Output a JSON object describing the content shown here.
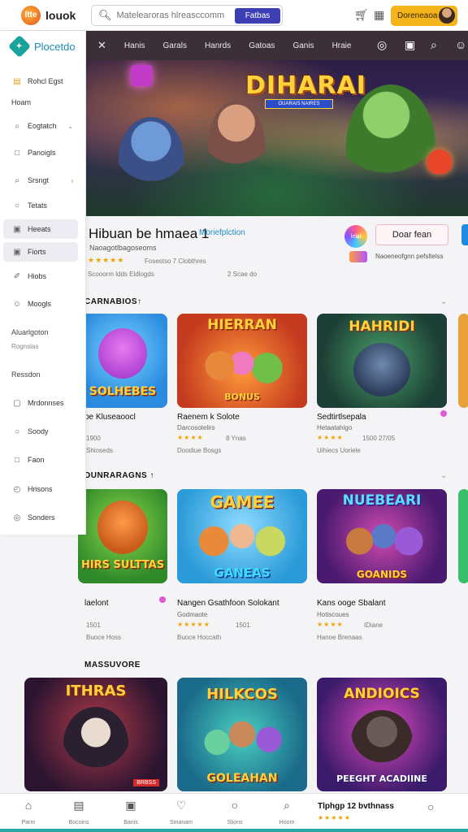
{
  "header": {
    "logo_badge": "ltte",
    "logo_text": "louok",
    "search_placeholder": "Matelearoras hlreasccomm",
    "search_button": "Fatbas",
    "deposit_label": "Doreneaoa"
  },
  "navbar": {
    "items": [
      "Hanis",
      "Garals",
      "Hanrds",
      "Gatoas",
      "Ganis",
      "Hraie"
    ]
  },
  "sidebar": {
    "brand": "Plocetdo",
    "items": [
      {
        "label": "Rohcl Egst",
        "icon": "card-icon"
      },
      {
        "label": "Hoam",
        "icon": "text"
      },
      {
        "label": "Eogtatch",
        "icon": "search-icon"
      },
      {
        "label": "Panoigls",
        "icon": "box-icon"
      },
      {
        "label": "Srsngt",
        "icon": "search-icon"
      },
      {
        "label": "Tetats",
        "icon": "chat-icon"
      },
      {
        "label": "Heeats",
        "icon": "box-icon"
      },
      {
        "label": "Fiorts",
        "icon": "box-icon"
      },
      {
        "label": "Hiobs",
        "icon": "pen-icon"
      },
      {
        "label": "Moogls",
        "icon": "smile-icon"
      }
    ],
    "group_label": "Aluarlgoton",
    "group_sub": "Rognslas",
    "section2": "Ressdon",
    "items2": [
      {
        "label": "Mrdonnses",
        "icon": "box-icon"
      },
      {
        "label": "Soody",
        "icon": "chat-icon"
      },
      {
        "label": "Faon",
        "icon": "box-icon"
      },
      {
        "label": "Hrisons",
        "icon": "clock-icon"
      },
      {
        "label": "Sonders",
        "icon": "chat-icon"
      }
    ]
  },
  "hero": {
    "title": "DIHARAI",
    "subtitle": "OUARAIS NAIRES"
  },
  "detail": {
    "title": "Hibuan be hmaea 1",
    "tag": "Moriefplction",
    "subtitle": "Naoagotlbagoseoms",
    "stars": "★★★★★",
    "meta": "Fosestso 7 Clobthres",
    "line2": "Scooorm   ldds    Eldlogds",
    "line2b": "2 Scae do",
    "app_icon_text": "lelal",
    "download_label": "Doar fean",
    "more_text": "Naoeneofgnn pefsltelss"
  },
  "sections": [
    {
      "title": "CARNABIOS↑",
      "cards": [
        {
          "title": "SOLHEBES",
          "name": "oe Kluseaoocl",
          "sub": "",
          "stars": "★★★★★",
          "count": "1900",
          "meta": "Shioseds"
        },
        {
          "title": "HIERRAN",
          "badge": "BONUS",
          "name": "Raenem k Solote",
          "sub": "Darcosotelirs",
          "stars": "★★★★",
          "count": "8 Ynas",
          "meta": "Doodiue  Bosgs"
        },
        {
          "title": "HAHRIDI",
          "name": "Sedtirtlsepala",
          "sub": "Hetaatahigo",
          "stars": "★★★★",
          "count": "1500 27/05",
          "meta": "Uihiecs  Uoriele"
        }
      ]
    },
    {
      "title": "DUNRARAGNS ↑",
      "cards": [
        {
          "title": "HIRS SULTTAS",
          "name": "laelont",
          "sub": "",
          "stars": "",
          "count": "1501",
          "meta": "Buoce  Hoss"
        },
        {
          "title": "GAMEE",
          "badge": "GANEAS",
          "name": "Nangen Gsathfoon Solokant",
          "sub": "Godmaote",
          "stars": "★★★★★",
          "count": "1501",
          "meta": "Buoce  Hoccath"
        },
        {
          "title": "NUEBEARI",
          "badge": "GOANIDS",
          "name": "Kans ooge Sbalant",
          "sub": "Hotiscoues",
          "stars": "★★★★",
          "count": "IDiane",
          "meta": "Hanoe  Brenaas"
        }
      ]
    },
    {
      "title": "MASSUVORE",
      "cards": [
        {
          "title": "ITHRAS",
          "badge": "BRBSS"
        },
        {
          "title": "HILKCOS",
          "badge": "GOLEAHAN"
        },
        {
          "title": "ANDIOICS",
          "badge": "PEEGHT ACADIINE"
        }
      ]
    }
  ],
  "bottom_nav": {
    "items": [
      "Parm",
      "Bocoins",
      "Banis",
      "Smanam",
      "Slions",
      "Hoom"
    ],
    "title": "Tlphgp 12 bvthnass",
    "stars": "★★★★★"
  },
  "colors": {
    "accent": "#3b3fb3",
    "deposit": "#f3b41c",
    "navbar": "#3b2f38",
    "brand": "#1a8fb0",
    "stars": "#f0a400"
  }
}
